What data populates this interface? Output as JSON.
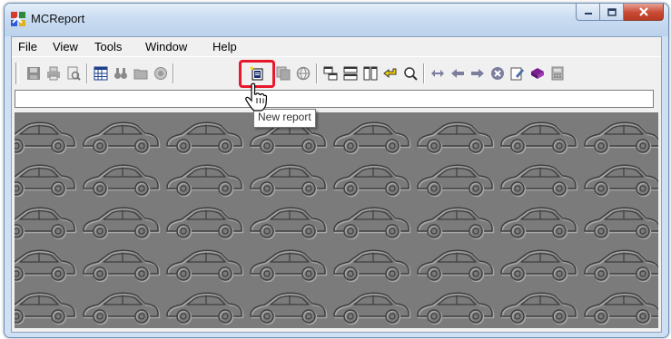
{
  "window": {
    "title": "MCReport",
    "app_icon": "mcreport-app-icon",
    "controls": [
      "minimize-icon",
      "maximize-icon",
      "close-icon"
    ]
  },
  "menubar": {
    "items": [
      {
        "label": "File"
      },
      {
        "label": "View"
      },
      {
        "label": "Tools"
      },
      {
        "label": "Window"
      },
      {
        "label": "Help"
      }
    ]
  },
  "toolbar": {
    "buttons": [
      {
        "icon": "save-icon",
        "enabled": false
      },
      {
        "icon": "print-icon",
        "enabled": false
      },
      {
        "icon": "print-preview-icon",
        "enabled": false
      },
      {
        "icon": "table-grid-icon",
        "enabled": true
      },
      {
        "icon": "find-binoculars-icon",
        "enabled": false
      },
      {
        "icon": "folder-icon",
        "enabled": false
      },
      {
        "icon": "database-icon",
        "enabled": false
      },
      {
        "icon": "new-report-icon",
        "enabled": true,
        "highlighted": true
      },
      {
        "icon": "report-pages-icon",
        "enabled": false
      },
      {
        "icon": "globe-icon",
        "enabled": false
      },
      {
        "icon": "tile-cascade-icon",
        "enabled": true
      },
      {
        "icon": "tile-horizontal-icon",
        "enabled": true
      },
      {
        "icon": "tile-vertical-icon",
        "enabled": true
      },
      {
        "icon": "return-arrow-icon",
        "enabled": true
      },
      {
        "icon": "zoom-icon",
        "enabled": true
      },
      {
        "icon": "double-arrow-icon",
        "enabled": true
      },
      {
        "icon": "back-arrow-icon",
        "enabled": true
      },
      {
        "icon": "forward-arrow-icon",
        "enabled": true
      },
      {
        "icon": "stop-icon",
        "enabled": true
      },
      {
        "icon": "edit-document-icon",
        "enabled": true
      },
      {
        "icon": "book-icon",
        "enabled": true
      },
      {
        "icon": "calculator-icon",
        "enabled": true
      }
    ]
  },
  "tooltip": {
    "text": "New report"
  },
  "address_bar": {
    "value": ""
  },
  "colors": {
    "highlight_border": "#e8182b",
    "workspace_bg": "#7a7a7a",
    "title_gradient_top": "#e4eef9",
    "close_button": "#c84a34"
  }
}
